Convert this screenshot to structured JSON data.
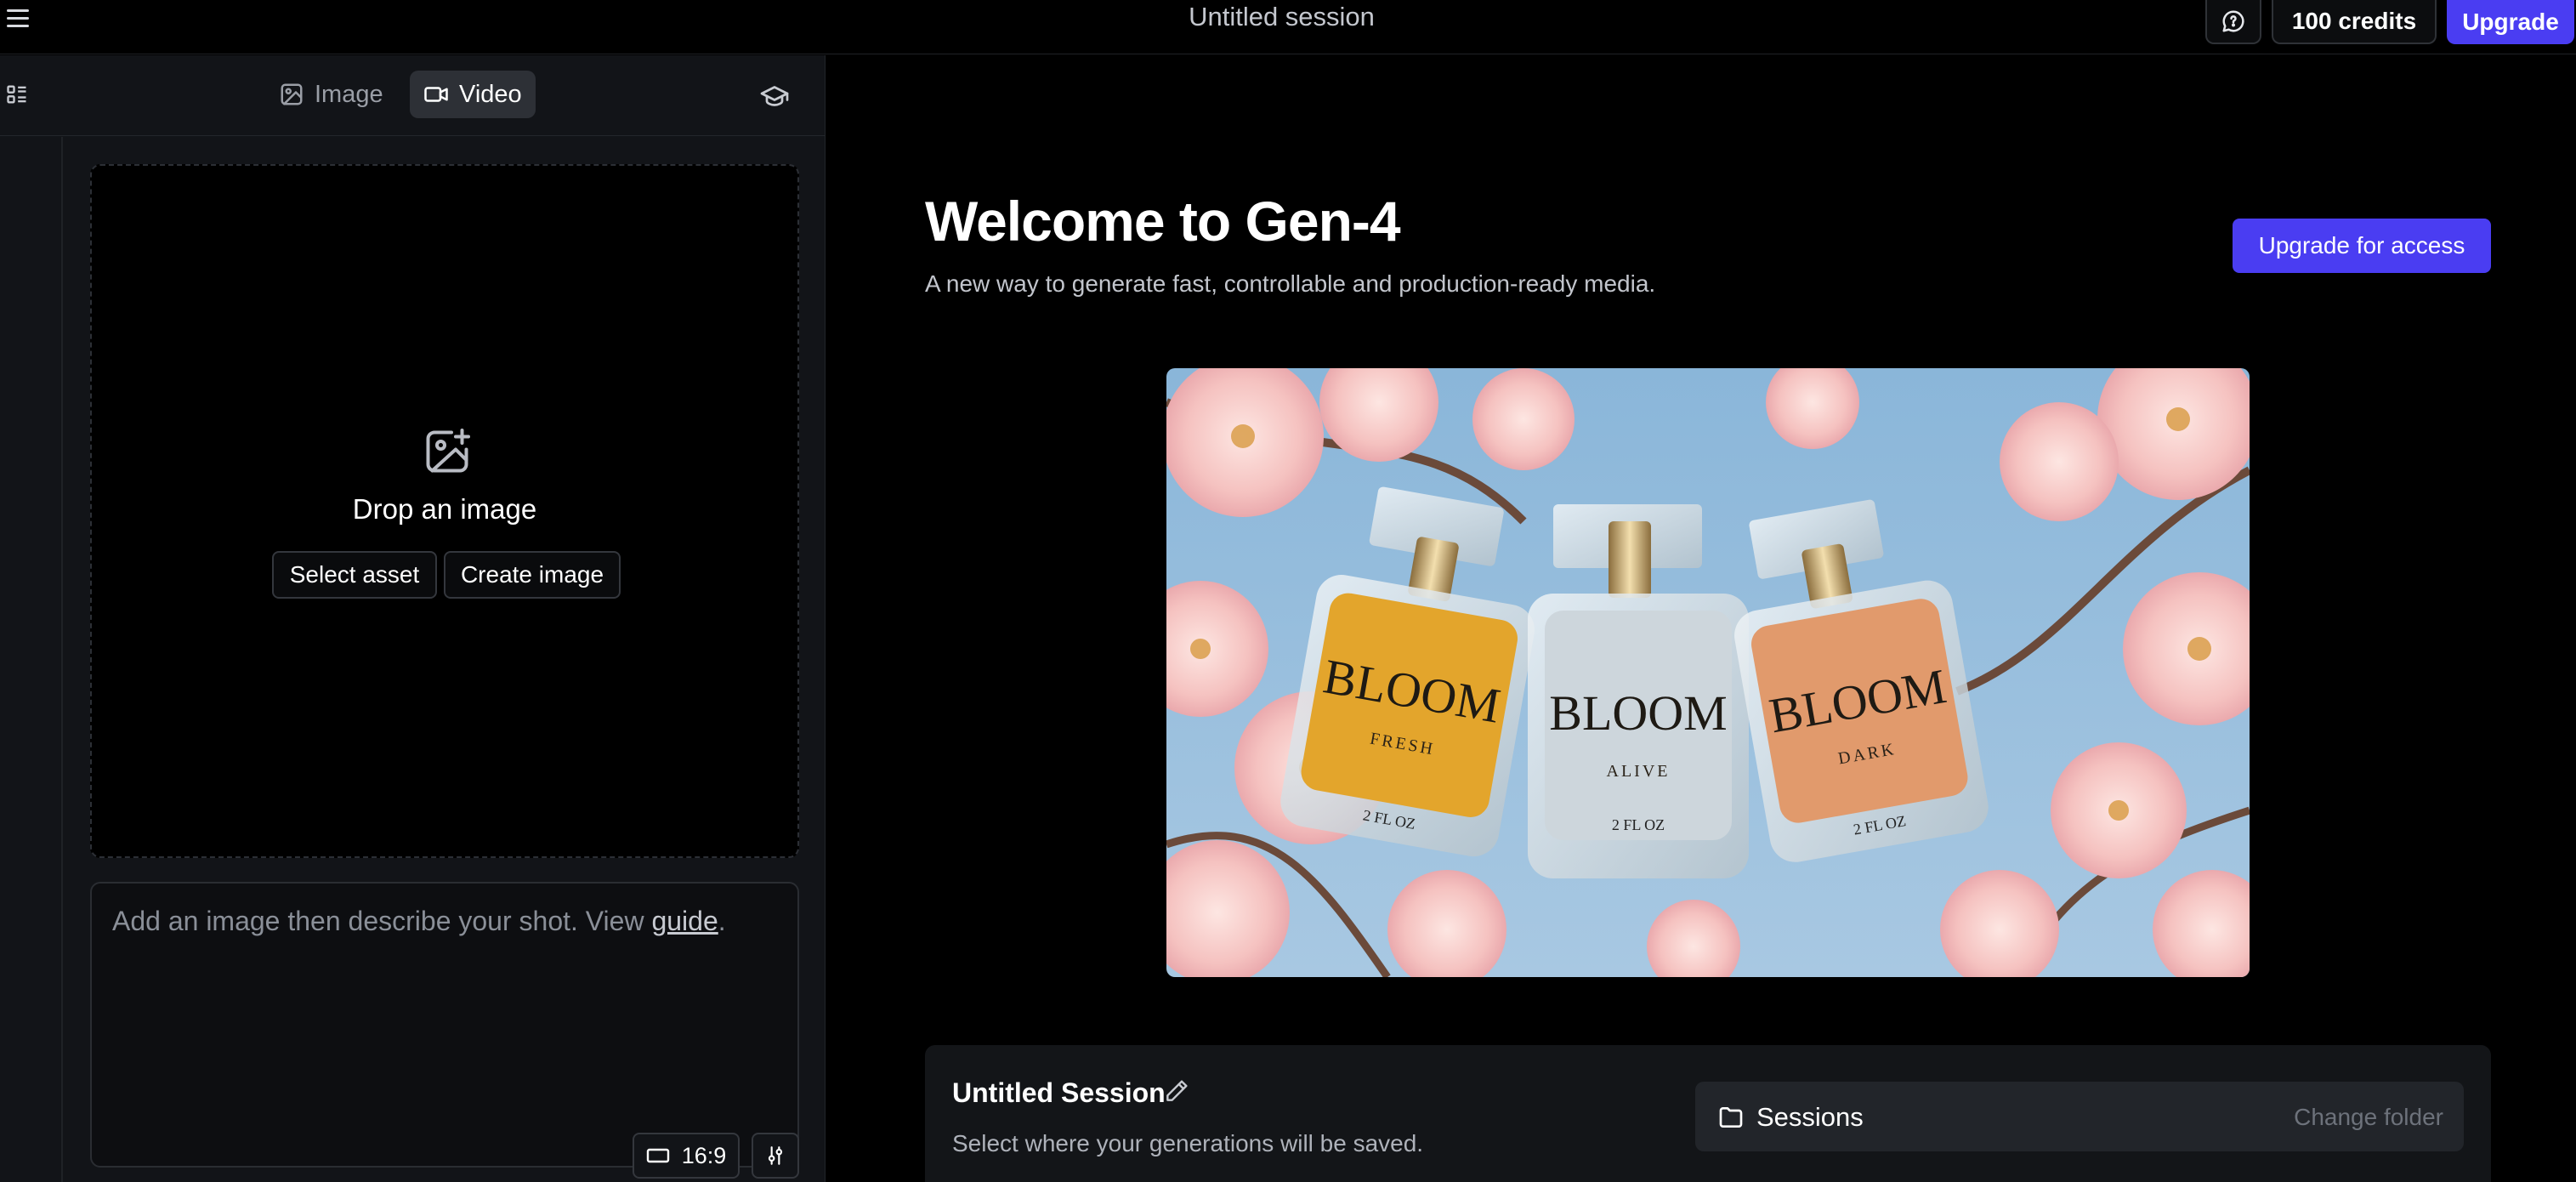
{
  "topbar": {
    "session_title": "Untitled session",
    "credits_label": "100 credits",
    "upgrade_label": "Upgrade"
  },
  "left_panel": {
    "tabs": [
      {
        "label": "Image",
        "icon": "image-icon",
        "active": false
      },
      {
        "label": "Video",
        "icon": "video-icon",
        "active": true
      }
    ],
    "dropzone": {
      "title": "Drop an image",
      "select_asset_label": "Select asset",
      "create_image_label": "Create image"
    },
    "prompt": {
      "placeholder_text": "Add an image then describe your shot. View ",
      "link_text": "guide",
      "trailing": "."
    },
    "aspect_ratio": "16:9"
  },
  "main": {
    "welcome_title": "Welcome to Gen-4",
    "welcome_subtitle": "A new way to generate fast, controllable and production-ready media.",
    "access_button_label": "Upgrade for access",
    "hero_bottles": [
      {
        "brand": "BLOOM",
        "variant": "FRESH",
        "size": "2 FL OZ",
        "color": "#e3a52c"
      },
      {
        "brand": "BLOOM",
        "variant": "ALIVE",
        "size": "2 FL OZ",
        "color": "#c7d0d6"
      },
      {
        "brand": "BLOOM",
        "variant": "DARK",
        "size": "2 FL OZ",
        "color": "#e19a6c"
      }
    ],
    "session_card": {
      "title": "Untitled Session",
      "subtitle": "Select where your generations will be saved.",
      "folder_name": "Sessions",
      "change_folder_label": "Change folder"
    }
  },
  "colors": {
    "accent": "#4a3df2",
    "panel_bg": "#121418",
    "background": "#000000"
  }
}
